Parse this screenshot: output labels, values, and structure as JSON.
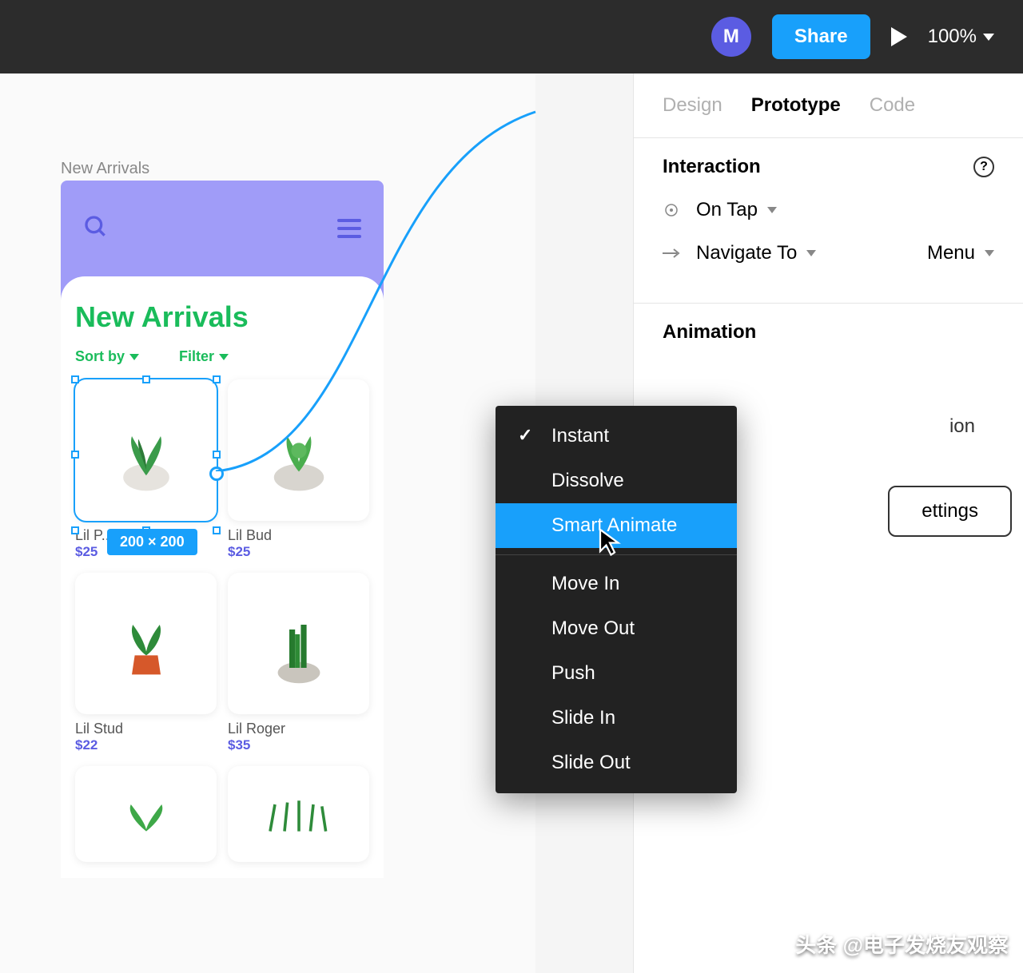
{
  "topbar": {
    "avatar_initial": "M",
    "share_label": "Share",
    "zoom_level": "100%"
  },
  "canvas": {
    "frame_label": "New Arrivals",
    "mobile": {
      "title": "New Arrivals",
      "sort_label": "Sort by",
      "filter_label": "Filter",
      "products": [
        {
          "name": "Lil P...",
          "price": "$25"
        },
        {
          "name": "Lil Bud",
          "price": "$25"
        },
        {
          "name": "Lil Stud",
          "price": "$22"
        },
        {
          "name": "Lil Roger",
          "price": "$35"
        }
      ],
      "selection_size": "200 × 200"
    }
  },
  "panel": {
    "tabs": [
      "Design",
      "Prototype",
      "Code"
    ],
    "active_tab": "Prototype",
    "interaction": {
      "title": "Interaction",
      "trigger": "On Tap",
      "action": "Navigate To",
      "target": "Menu"
    },
    "animation": {
      "title": "Animation",
      "overflow_partial": "ion",
      "settings_partial": "ettings"
    }
  },
  "dropdown": {
    "items": [
      "Instant",
      "Dissolve",
      "Smart Animate",
      "Move In",
      "Move Out",
      "Push",
      "Slide In",
      "Slide Out"
    ],
    "checked": "Instant",
    "hovered": "Smart Animate",
    "sep_after_index": 2
  },
  "watermark": "头条 @电子发烧友观察"
}
